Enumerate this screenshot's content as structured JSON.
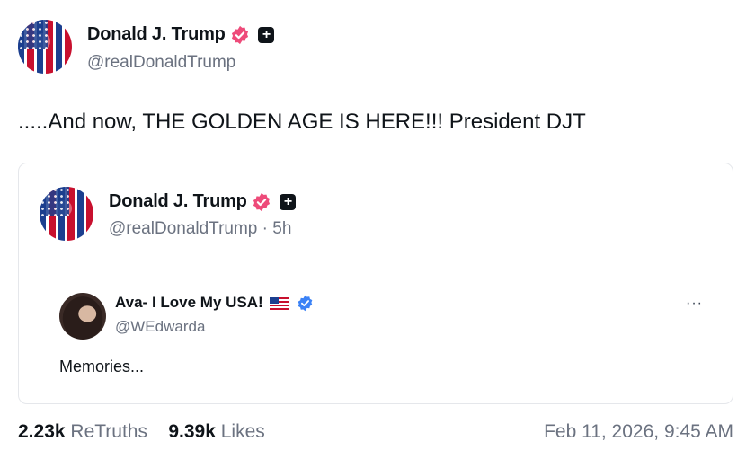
{
  "post": {
    "author_name": "Donald J. Trump",
    "author_handle": "@realDonaldTrump",
    "text": ".....And now, THE GOLDEN AGE IS HERE!!! President DJT",
    "plus_badge": "+"
  },
  "quoted": {
    "author_name": "Donald J. Trump",
    "author_handle": "@realDonaldTrump",
    "time": " · 5h",
    "plus_badge": "+",
    "inner": {
      "author_name": "Ava- I Love My USA!",
      "author_handle": "@WEdwarda",
      "more": "···",
      "text": "Memories..."
    }
  },
  "stats": {
    "retruths_count": "2.23k",
    "retruths_label": "ReTruths",
    "likes_count": "9.39k",
    "likes_label": "Likes",
    "date": "Feb 11, 2026, 9:45 AM"
  },
  "colors": {
    "verified_badge": "#ee4b7a",
    "blue_verified": "#3b82f6",
    "muted": "#6b7280"
  }
}
